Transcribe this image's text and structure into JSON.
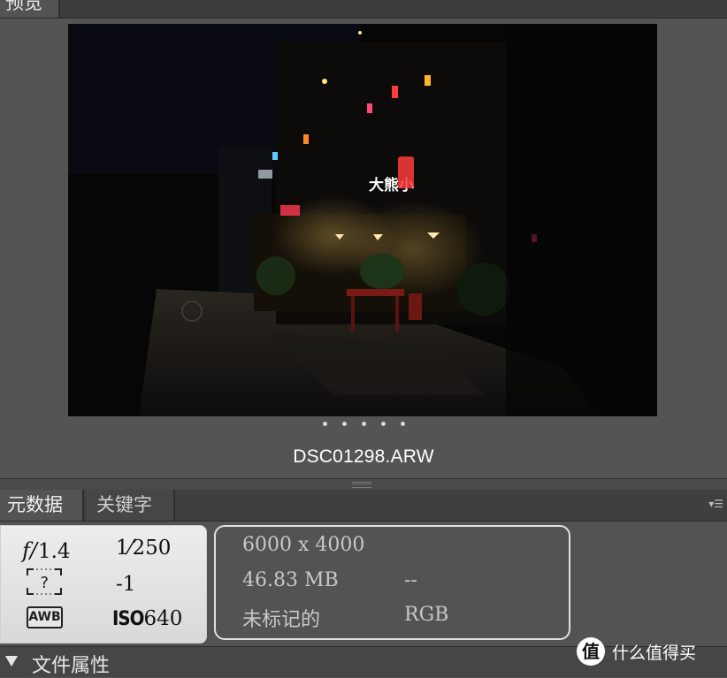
{
  "preview_panel": {
    "tab_label": "预览",
    "filename": "DSC01298.ARW",
    "page_dots": 5,
    "photo_signs": {
      "restaurant_sign": "大熊小"
    }
  },
  "metadata_panel": {
    "tabs": [
      {
        "label": "元数据",
        "active": true
      },
      {
        "label": "关键字",
        "active": false
      }
    ],
    "menu_icon": "panel-menu-icon",
    "exposure": {
      "aperture_prefix": "f/",
      "aperture": "1.4",
      "shutter_numerator": "1",
      "shutter_denominator": "250",
      "metering_icon": "metering-mode-unknown-icon",
      "metering_glyph": "?",
      "exposure_comp": "-1",
      "white_balance": "AWB",
      "iso_label": "ISO",
      "iso_value": "640"
    },
    "file_properties": {
      "dimensions": "6000 x 4000",
      "file_size": "46.83 MB",
      "resolution": "--",
      "color_label": "未标记的",
      "color_mode": "RGB"
    }
  },
  "section": {
    "title": "文件属性",
    "expanded": true
  },
  "watermark": {
    "badge": "值",
    "text": "什么值得买"
  }
}
